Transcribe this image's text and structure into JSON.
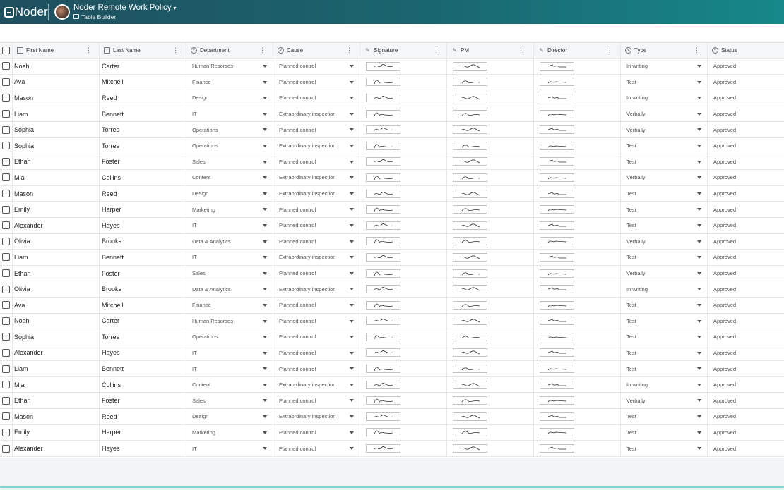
{
  "header": {
    "brand": "Noder",
    "doc_title": "Noder Remote Work Policy",
    "doc_subtitle": "Table Builder"
  },
  "table": {
    "columns": [
      "First Name",
      "Last Name",
      "Department",
      "Cause",
      "Signature",
      "PM",
      "Director",
      "Type",
      "Status"
    ],
    "rows": [
      [
        "Noah",
        "Carter",
        "Human Resorses",
        "Planned control",
        "In writing",
        "Approved"
      ],
      [
        "Ava",
        "Mitchell",
        "Finance",
        "Planned control",
        "Test",
        "Approved"
      ],
      [
        "Mason",
        "Reed",
        "Design",
        "Planned control",
        "In writing",
        "Approved"
      ],
      [
        "Liam",
        "Bennett",
        "IT",
        "Extraordinary inspection",
        "Verbally",
        "Approved"
      ],
      [
        "Sophia",
        "Torres",
        "Operations",
        "Planned control",
        "Verbally",
        "Approved"
      ],
      [
        "Sophia",
        "Torres",
        "Operations",
        "Extraordinary inspection",
        "Test",
        "Approved"
      ],
      [
        "Ethan",
        "Foster",
        "Sales",
        "Planned control",
        "Test",
        "Approved"
      ],
      [
        " Mia",
        "Collins",
        "Content",
        "Extraordinary inspection",
        "Verbally",
        "Approved"
      ],
      [
        "Mason",
        "Reed",
        "Design",
        "Extraordinary inspection",
        "Test",
        "Approved"
      ],
      [
        "Emily",
        "Harper",
        "Marketing",
        "Planned control",
        "Test",
        "Approved"
      ],
      [
        "Alexander",
        "Hayes",
        "IT",
        "Planned control",
        "Test",
        "Approved"
      ],
      [
        "Olivia",
        "Brooks",
        "Data & Analytics",
        "Planned control",
        "Verbally",
        "Approved"
      ],
      [
        "Liam",
        "Bennett",
        "IT",
        "Extraordinary inspection",
        "Test",
        "Approved"
      ],
      [
        "Ethan",
        "Foster",
        "Sales",
        "Planned control",
        "Verbally",
        "Approved"
      ],
      [
        "Olivia",
        "Brooks",
        "Data & Analytics",
        "Extraordinary inspection",
        "In writing",
        "Approved"
      ],
      [
        "Ava",
        "Mitchell",
        "Finance",
        "Planned control",
        "Test",
        "Approved"
      ],
      [
        "Noah",
        "Carter",
        "Human Resorses",
        "Planned control",
        "Test",
        "Approved"
      ],
      [
        "Sophia",
        "Torres",
        "Operations",
        "Planned control",
        "Test",
        "Approved"
      ],
      [
        "Alexander",
        "Hayes",
        "IT",
        "Planned control",
        "Test",
        "Approved"
      ],
      [
        "Liam",
        "Bennett",
        "IT",
        "Planned control",
        "Test",
        "Approved"
      ],
      [
        "Mia",
        "Collins",
        "Content",
        "Extraordinary inspection",
        "In writing",
        "Approved"
      ],
      [
        "Ethan",
        "Foster",
        "Sales",
        "Planned control",
        "Verbally",
        "Approved"
      ],
      [
        "Mason",
        "Reed",
        "Design",
        "Extraordinary inspection",
        "Test",
        "Approved"
      ],
      [
        "Emily",
        "Harper",
        "Marketing",
        "Planned control",
        "Test",
        "Approved"
      ],
      [
        "Alexander",
        "Hayes",
        "IT",
        "Planned control",
        "Test",
        "Approved"
      ]
    ]
  },
  "colors": {
    "header_gradient_start": "#1f4f5e",
    "header_gradient_end": "#16888a",
    "footer_accent": "#7fd3d0"
  },
  "icons": {
    "first_name": "text-field-icon",
    "last_name": "text-field-icon",
    "department": "select-circle-icon",
    "cause": "select-circle-icon",
    "signature": "signature-icon",
    "pm": "signature-icon",
    "director": "signature-icon",
    "type": "select-circle-icon",
    "status": "select-circle-icon"
  }
}
